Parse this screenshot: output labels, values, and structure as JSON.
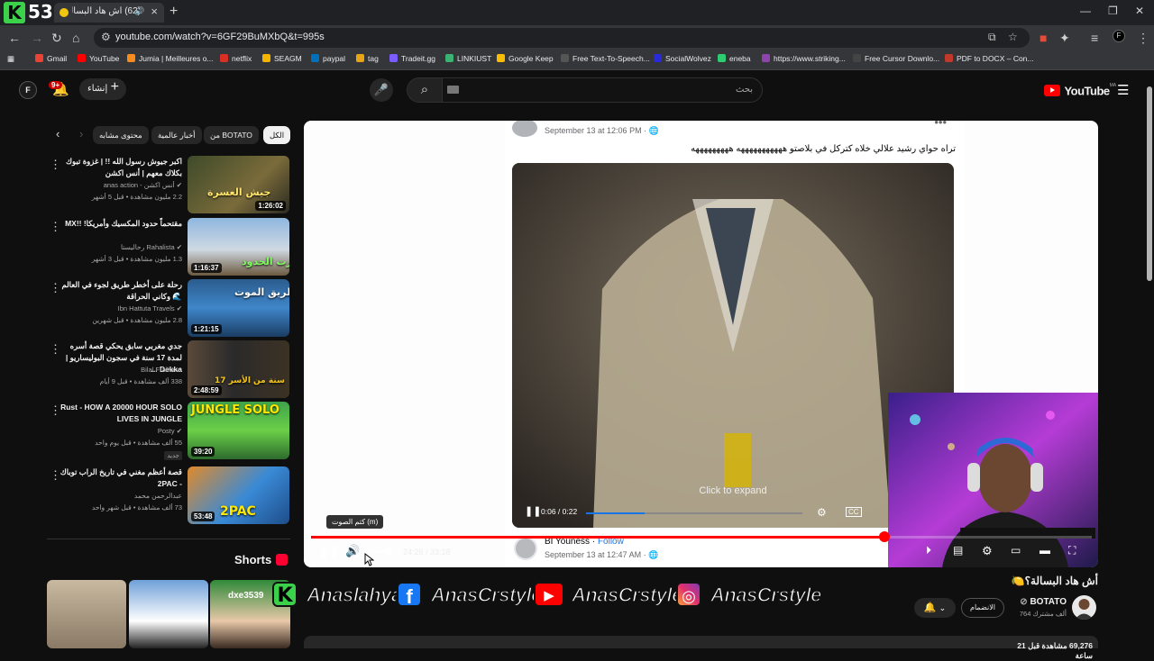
{
  "browser": {
    "logo_letter": "K",
    "logo_number": "53",
    "tab_title": "(62) أش هاد البسالة؟🍋",
    "url": "youtube.com/watch?v=6GF29BuMXbQ&t=995s",
    "bookmarks": [
      "Gmail",
      "YouTube",
      "Jumia | Meilleures o...",
      "netflix",
      "SEAGM",
      "paypal",
      "tag",
      "Tradeit.gg",
      "LINKIUST",
      "Google Keep",
      "Free Text-To-Speech...",
      "SocialWolvez",
      "eneba",
      "https://www.striking...",
      "Free Cursor Downlo...",
      "PDF to DOCX – Con..."
    ],
    "bookmark_colors": [
      "#ea4335",
      "#ff0000",
      "#f68b1e",
      "#d93025",
      "#f4b400",
      "#0070ba",
      "#e8a317",
      "#7b5cff",
      "#3bb273",
      "#fbbc04",
      "#555555",
      "#2a2ad8",
      "#2ecc71",
      "#8e44ad",
      "#444444",
      "#c0392b"
    ]
  },
  "header": {
    "avatar_letter": "F",
    "notif_count": "9+",
    "create_label": "إنشاء",
    "search_placeholder": "بحث",
    "logo_text": "YouTube",
    "logo_region": "MA"
  },
  "chips": [
    "الكل",
    "من BOTATO",
    "أخبار عالمية",
    "محتوى مشابه"
  ],
  "recommendations": [
    {
      "title": "اكبر جيوش رسول الله !! | غزوة تبوك بكلاك معهم | أنس اكشن",
      "channel": "anas action - أنس اكشن ✔",
      "meta": "2.2 مليون مشاهدة • قبل 5 أشهر",
      "duration": "1:26:02",
      "thumb_text": "جيش العسرة"
    },
    {
      "title": "مقتحماً حدود المكسيك وأمريكا! !!MX",
      "channel": "رحاليستا Rahalista ✔",
      "meta": "1.3 مليون مشاهدة • قبل 3 أشهر",
      "duration": "1:16:37",
      "thumb_text": "عبرت الحدود"
    },
    {
      "title": "رحلة على أخطر طريق لجوء في العالم 🌊 وكاني الحراقة",
      "channel": "Ibn Hattuta Travels ✔",
      "meta": "2.8 مليون مشاهدة • قبل شهرين",
      "duration": "1:21:15",
      "thumb_text": "طريق الموت"
    },
    {
      "title": "جدي مغربي سابق يحكي قصة أسره لمدة 17 سنة في سجون البوليساريو | Dekka ...",
      "channel": "Bilal Fraiha ✔",
      "meta": "338 ألف مشاهدة • قبل 9 أيام",
      "duration": "2:48:59",
      "thumb_text": "17 سنة من الأسر"
    },
    {
      "title": "Rust - HOW A 20000 HOUR SOLO LIVES IN JUNGLE",
      "channel": "Posty ✔",
      "meta": "55 ألف مشاهدة • قبل يوم واحد",
      "duration": "39:20",
      "thumb_text": "JUNGLE SOLO",
      "badge": "جديد"
    },
    {
      "title": "قصة أعظم مغني في تاريخ الراب توباك - 2PAC",
      "channel": "عبدالرحمن محمد",
      "meta": "73 ألف مشاهدة • قبل شهر واحد",
      "duration": "53:48",
      "thumb_text": "2PAC"
    }
  ],
  "shorts": {
    "label": "Shorts",
    "short3_text": "dxe3539"
  },
  "facebook": {
    "date": "September 13 at 12:06 PM · 🌐",
    "text": "تراه حواي رشيد علالي خلاه كتركل في بلاصتو هههههههههههه هههههههههه",
    "video_time": "0:06 / 0:22",
    "video_progress": 0.27,
    "click_to_expand": "Click to expand",
    "poster": "BI Youness",
    "follow": "Follow",
    "date2": "September 13 at 12:47 AM · 🌐"
  },
  "player": {
    "time": "24:26 / 33:18",
    "progress": 0.734,
    "volume": 0.7,
    "mute_tooltip": "كتم الصوت (m)"
  },
  "video": {
    "title": "أش هاد البسالة؟🍋",
    "channel": "BOTATO",
    "subs": "764 ألف مشترك",
    "join": "الانضمام",
    "views": "69,276 مشاهدة قبل 21 ساعة"
  },
  "banner": {
    "items": [
      {
        "icon": "K",
        "text": "Anaslahya"
      },
      {
        "icon": "f",
        "text": "AnasCrstyle"
      },
      {
        "icon": "▶",
        "text": "AnasCrstyle"
      },
      {
        "icon": "◎",
        "text": "AnasCrstyle"
      }
    ]
  },
  "colors": {
    "accent": "#ff0000",
    "fb_blue": "#1b74e4",
    "kick_green": "#3bd14a"
  }
}
